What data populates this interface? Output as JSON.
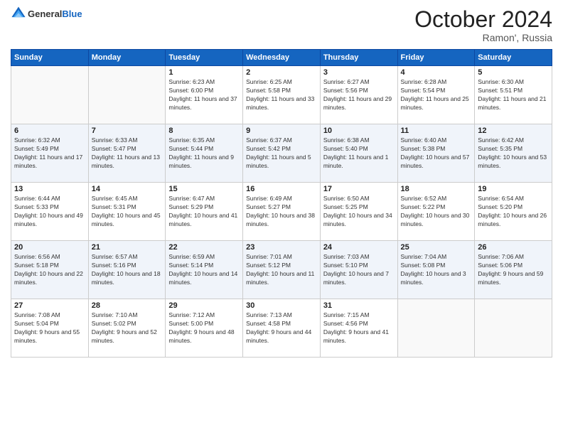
{
  "header": {
    "logo_general": "General",
    "logo_blue": "Blue",
    "month_title": "October 2024",
    "location": "Ramon', Russia"
  },
  "days_of_week": [
    "Sunday",
    "Monday",
    "Tuesday",
    "Wednesday",
    "Thursday",
    "Friday",
    "Saturday"
  ],
  "weeks": [
    [
      {
        "day": "",
        "info": ""
      },
      {
        "day": "",
        "info": ""
      },
      {
        "day": "1",
        "info": "Sunrise: 6:23 AM\nSunset: 6:00 PM\nDaylight: 11 hours and 37 minutes."
      },
      {
        "day": "2",
        "info": "Sunrise: 6:25 AM\nSunset: 5:58 PM\nDaylight: 11 hours and 33 minutes."
      },
      {
        "day": "3",
        "info": "Sunrise: 6:27 AM\nSunset: 5:56 PM\nDaylight: 11 hours and 29 minutes."
      },
      {
        "day": "4",
        "info": "Sunrise: 6:28 AM\nSunset: 5:54 PM\nDaylight: 11 hours and 25 minutes."
      },
      {
        "day": "5",
        "info": "Sunrise: 6:30 AM\nSunset: 5:51 PM\nDaylight: 11 hours and 21 minutes."
      }
    ],
    [
      {
        "day": "6",
        "info": "Sunrise: 6:32 AM\nSunset: 5:49 PM\nDaylight: 11 hours and 17 minutes."
      },
      {
        "day": "7",
        "info": "Sunrise: 6:33 AM\nSunset: 5:47 PM\nDaylight: 11 hours and 13 minutes."
      },
      {
        "day": "8",
        "info": "Sunrise: 6:35 AM\nSunset: 5:44 PM\nDaylight: 11 hours and 9 minutes."
      },
      {
        "day": "9",
        "info": "Sunrise: 6:37 AM\nSunset: 5:42 PM\nDaylight: 11 hours and 5 minutes."
      },
      {
        "day": "10",
        "info": "Sunrise: 6:38 AM\nSunset: 5:40 PM\nDaylight: 11 hours and 1 minute."
      },
      {
        "day": "11",
        "info": "Sunrise: 6:40 AM\nSunset: 5:38 PM\nDaylight: 10 hours and 57 minutes."
      },
      {
        "day": "12",
        "info": "Sunrise: 6:42 AM\nSunset: 5:35 PM\nDaylight: 10 hours and 53 minutes."
      }
    ],
    [
      {
        "day": "13",
        "info": "Sunrise: 6:44 AM\nSunset: 5:33 PM\nDaylight: 10 hours and 49 minutes."
      },
      {
        "day": "14",
        "info": "Sunrise: 6:45 AM\nSunset: 5:31 PM\nDaylight: 10 hours and 45 minutes."
      },
      {
        "day": "15",
        "info": "Sunrise: 6:47 AM\nSunset: 5:29 PM\nDaylight: 10 hours and 41 minutes."
      },
      {
        "day": "16",
        "info": "Sunrise: 6:49 AM\nSunset: 5:27 PM\nDaylight: 10 hours and 38 minutes."
      },
      {
        "day": "17",
        "info": "Sunrise: 6:50 AM\nSunset: 5:25 PM\nDaylight: 10 hours and 34 minutes."
      },
      {
        "day": "18",
        "info": "Sunrise: 6:52 AM\nSunset: 5:22 PM\nDaylight: 10 hours and 30 minutes."
      },
      {
        "day": "19",
        "info": "Sunrise: 6:54 AM\nSunset: 5:20 PM\nDaylight: 10 hours and 26 minutes."
      }
    ],
    [
      {
        "day": "20",
        "info": "Sunrise: 6:56 AM\nSunset: 5:18 PM\nDaylight: 10 hours and 22 minutes."
      },
      {
        "day": "21",
        "info": "Sunrise: 6:57 AM\nSunset: 5:16 PM\nDaylight: 10 hours and 18 minutes."
      },
      {
        "day": "22",
        "info": "Sunrise: 6:59 AM\nSunset: 5:14 PM\nDaylight: 10 hours and 14 minutes."
      },
      {
        "day": "23",
        "info": "Sunrise: 7:01 AM\nSunset: 5:12 PM\nDaylight: 10 hours and 11 minutes."
      },
      {
        "day": "24",
        "info": "Sunrise: 7:03 AM\nSunset: 5:10 PM\nDaylight: 10 hours and 7 minutes."
      },
      {
        "day": "25",
        "info": "Sunrise: 7:04 AM\nSunset: 5:08 PM\nDaylight: 10 hours and 3 minutes."
      },
      {
        "day": "26",
        "info": "Sunrise: 7:06 AM\nSunset: 5:06 PM\nDaylight: 9 hours and 59 minutes."
      }
    ],
    [
      {
        "day": "27",
        "info": "Sunrise: 7:08 AM\nSunset: 5:04 PM\nDaylight: 9 hours and 55 minutes."
      },
      {
        "day": "28",
        "info": "Sunrise: 7:10 AM\nSunset: 5:02 PM\nDaylight: 9 hours and 52 minutes."
      },
      {
        "day": "29",
        "info": "Sunrise: 7:12 AM\nSunset: 5:00 PM\nDaylight: 9 hours and 48 minutes."
      },
      {
        "day": "30",
        "info": "Sunrise: 7:13 AM\nSunset: 4:58 PM\nDaylight: 9 hours and 44 minutes."
      },
      {
        "day": "31",
        "info": "Sunrise: 7:15 AM\nSunset: 4:56 PM\nDaylight: 9 hours and 41 minutes."
      },
      {
        "day": "",
        "info": ""
      },
      {
        "day": "",
        "info": ""
      }
    ]
  ]
}
